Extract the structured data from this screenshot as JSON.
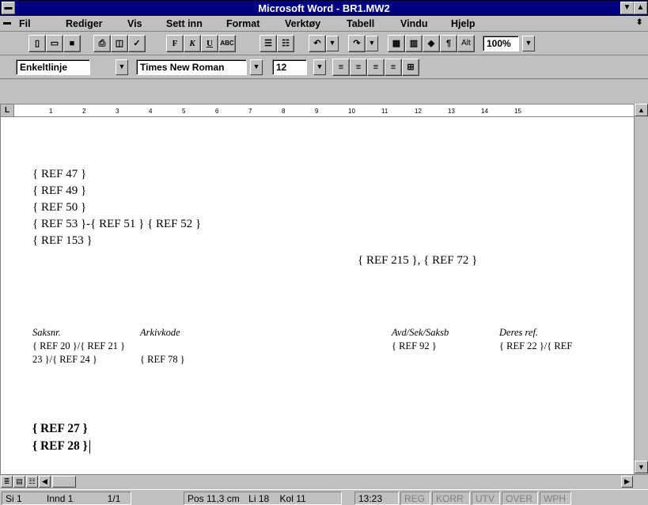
{
  "window": {
    "title": "Microsoft Word - BR1.MW2"
  },
  "menu": {
    "items": [
      "Fil",
      "Rediger",
      "Vis",
      "Sett inn",
      "Format",
      "Verktøy",
      "Tabell",
      "Vindu",
      "Hjelp"
    ]
  },
  "toolbar": {
    "bold": "F",
    "italic": "K",
    "underline": "U",
    "abc": "ABC",
    "alt": "Alt",
    "zoom": "100%"
  },
  "formatting": {
    "style": "Enkeltlinje",
    "font": "Times New Roman",
    "size": "12"
  },
  "ruler": {
    "marks": [
      "1",
      "2",
      "3",
      "4",
      "5",
      "6",
      "7",
      "8",
      "9",
      "10",
      "11",
      "12",
      "13",
      "14",
      "15"
    ]
  },
  "document": {
    "lines": [
      "{ REF 47 }",
      "{ REF 49 }",
      "{ REF 50 }",
      "{ REF 53 }-{ REF 51 } { REF 52 }",
      "{ REF 153 }"
    ],
    "right_ref": "{ REF  215 }, { REF 72 }",
    "header": {
      "saksnr_label": "Saksnr.",
      "arkivkode_label": "Arkivkode",
      "avd_label": "Avd/Sek/Saksb",
      "deres_label": "Deres ref.",
      "saksnr_value_1": "{ REF 20 }/{ REF 21 }",
      "saksnr_value_2": "23 }/{ REF 24 }",
      "arkivkode_value": "{ REF 78 }",
      "avd_value": "{ REF 92 }",
      "deres_value": "{ REF 22 }/{ REF"
    },
    "bold_lines": [
      "{ REF 27 }",
      "{ REF 28 }"
    ]
  },
  "status": {
    "page": "Si 1",
    "section": "Innd 1",
    "pages": "1/1",
    "pos": "Pos 11,3 cm",
    "line": "Li 18",
    "col": "Kol 11",
    "time": "13:23",
    "flags": [
      "REG",
      "KORR",
      "UTV",
      "OVER",
      "WPH"
    ]
  }
}
